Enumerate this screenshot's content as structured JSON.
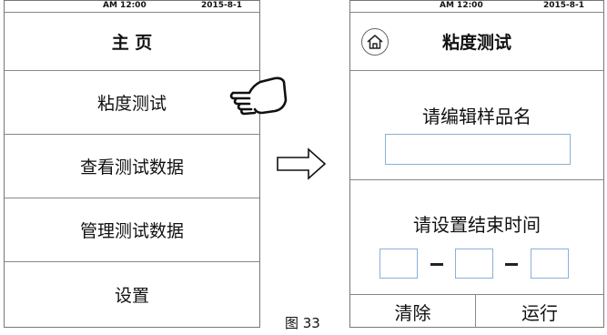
{
  "left_screen": {
    "status": {
      "time": "AM 12:00",
      "date": "2015-8-1"
    },
    "title": "主 页",
    "menu": [
      {
        "label": "粘度测试"
      },
      {
        "label": "查看测试数据"
      },
      {
        "label": "管理测试数据"
      },
      {
        "label": "设置"
      }
    ]
  },
  "right_screen": {
    "status": {
      "time": "AM 12:00",
      "date": "2015-8-1"
    },
    "title": "粘度测试",
    "sample_prompt": "请编辑样品名",
    "sample_input_value": "",
    "time_prompt": "请设置结束时间",
    "time_fields": [
      "",
      "",
      ""
    ],
    "buttons": {
      "clear": "清除",
      "run": "运行"
    }
  },
  "caption": "图 33",
  "icons": [
    "home-icon",
    "pointing-hand-icon",
    "right-arrow-icon"
  ]
}
